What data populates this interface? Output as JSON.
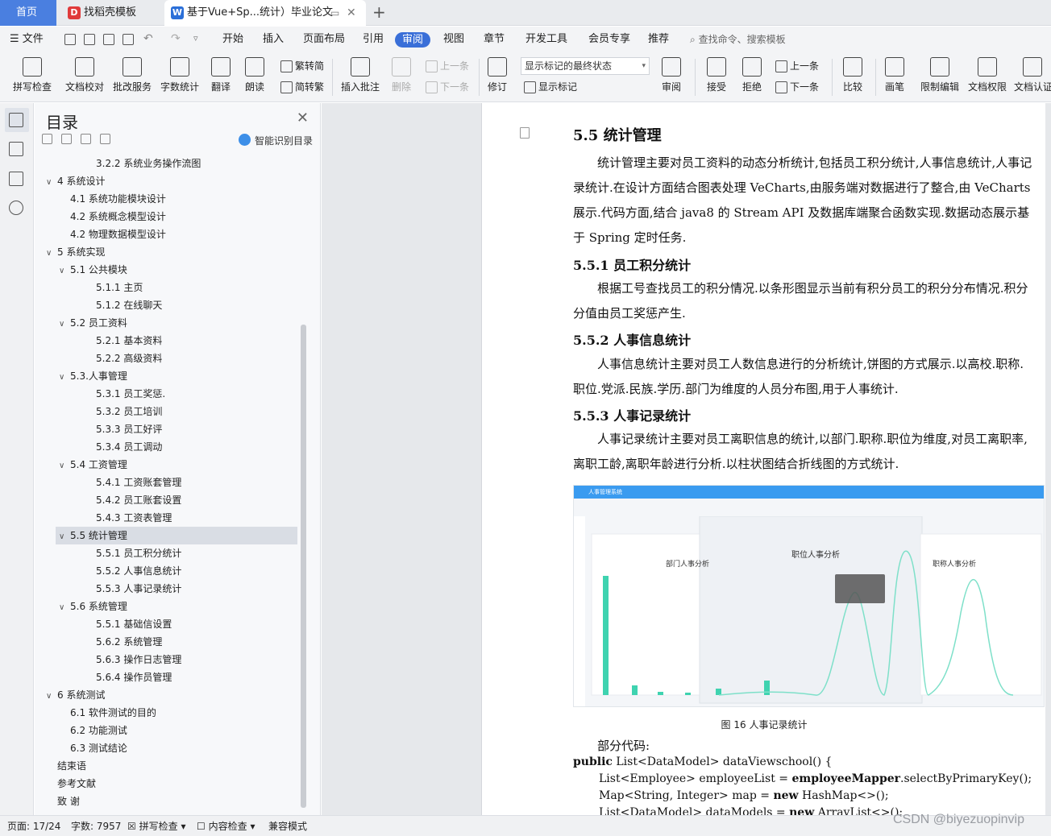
{
  "tabs": {
    "home": "首页",
    "template": "找稻壳模板",
    "doc": "基于Vue+Sp...统计）毕业论文"
  },
  "menu": {
    "file": "文件",
    "items": [
      "开始",
      "插入",
      "页面布局",
      "引用",
      "审阅",
      "视图",
      "章节",
      "开发工具",
      "会员专享",
      "推荐"
    ],
    "active": "审阅",
    "search": "查找命令、搜索模板"
  },
  "ribbon": {
    "spellcheck": "拼写检查",
    "doc_check": "文档校对",
    "batch_service": "批改服务",
    "word_count": "字数统计",
    "translate": "翻译",
    "read_aloud": "朗读",
    "trad_to_simp": "繁转简",
    "simp_to_trad": "简转繁",
    "insert_comment": "插入批注",
    "delete": "删除",
    "prev_comment": "上一条",
    "next_comment": "下一条",
    "revise": "修订",
    "markup_select": "显示标记的最终状态",
    "show_markup": "显示标记",
    "review": "审阅",
    "accept": "接受",
    "reject": "拒绝",
    "prev_change": "上一条",
    "next_change": "下一条",
    "compare": "比较",
    "ink": "画笔",
    "restrict_edit": "限制编辑",
    "doc_rights": "文档权限",
    "doc_auth": "文档认证"
  },
  "toc": {
    "title": "目录",
    "smart_detect": "智能识别目录",
    "items": [
      {
        "label": "3.2.2 系统业务操作流图",
        "level": 3,
        "arrow": ""
      },
      {
        "label": "4 系统设计",
        "level": 1,
        "arrow": "∨"
      },
      {
        "label": "4.1 系统功能模块设计",
        "level": 2,
        "arrow": ""
      },
      {
        "label": "4.2 系统概念模型设计",
        "level": 2,
        "arrow": ""
      },
      {
        "label": "4.2 物理数据模型设计",
        "level": 2,
        "arrow": ""
      },
      {
        "label": "5 系统实现",
        "level": 1,
        "arrow": "∨"
      },
      {
        "label": "5.1  公共模块",
        "level": 2,
        "arrow": "∨"
      },
      {
        "label": "5.1.1 主页",
        "level": 3,
        "arrow": ""
      },
      {
        "label": "5.1.2 在线聊天",
        "level": 3,
        "arrow": ""
      },
      {
        "label": "5.2  员工资料",
        "level": 2,
        "arrow": "∨"
      },
      {
        "label": "5.2.1 基本资料",
        "level": 3,
        "arrow": ""
      },
      {
        "label": "5.2.2  高级资料",
        "level": 3,
        "arrow": ""
      },
      {
        "label": "5.3.人事管理",
        "level": 2,
        "arrow": "∨"
      },
      {
        "label": "5.3.1 员工奖惩.",
        "level": 3,
        "arrow": ""
      },
      {
        "label": "5.3.2 员工培训",
        "level": 3,
        "arrow": ""
      },
      {
        "label": "5.3.3 员工好评",
        "level": 3,
        "arrow": ""
      },
      {
        "label": "5.3.4 员工调动",
        "level": 3,
        "arrow": ""
      },
      {
        "label": "5.4 工资管理",
        "level": 2,
        "arrow": "∨"
      },
      {
        "label": "5.4.1 工资账套管理",
        "level": 3,
        "arrow": ""
      },
      {
        "label": "5.4.2 员工账套设置",
        "level": 3,
        "arrow": ""
      },
      {
        "label": "5.4.3 工资表管理",
        "level": 3,
        "arrow": ""
      },
      {
        "label": "5.5 统计管理",
        "level": 2,
        "arrow": "∨",
        "selected": true
      },
      {
        "label": "5.5.1 员工积分统计",
        "level": 3,
        "arrow": ""
      },
      {
        "label": "5.5.2 人事信息统计",
        "level": 3,
        "arrow": ""
      },
      {
        "label": "5.5.3 人事记录统计",
        "level": 3,
        "arrow": ""
      },
      {
        "label": "5.6 系统管理",
        "level": 2,
        "arrow": "∨"
      },
      {
        "label": "5.5.1 基础信设置",
        "level": 3,
        "arrow": ""
      },
      {
        "label": "5.6.2 系统管理",
        "level": 3,
        "arrow": ""
      },
      {
        "label": "5.6.3 操作日志管理",
        "level": 3,
        "arrow": ""
      },
      {
        "label": "5.6.4 操作员管理",
        "level": 3,
        "arrow": ""
      },
      {
        "label": "6 系统测试",
        "level": 1,
        "arrow": "∨"
      },
      {
        "label": "6.1  软件测试的目的",
        "level": 2,
        "arrow": ""
      },
      {
        "label": "6.2  功能测试",
        "level": 2,
        "arrow": ""
      },
      {
        "label": "6.3  测试结论",
        "level": 2,
        "arrow": ""
      },
      {
        "label": "结束语",
        "level": 1,
        "arrow": ""
      },
      {
        "label": "参考文献",
        "level": 1,
        "arrow": ""
      },
      {
        "label": "致    谢",
        "level": 1,
        "arrow": ""
      }
    ]
  },
  "doc": {
    "h_55": "5.5 统计管理",
    "p_55": "统计管理主要对员工资料的动态分析统计,包括员工积分统计,人事信息统计,人事记录统计.在设计方面结合图表处理 VeCharts,由服务端对数据进行了整合,由 VeCharts 展示.代码方面,结合 java8 的 Stream API 及数据库端聚合函数实现.数据动态展示基于 Spring 定时任务.",
    "h_551": "5.5.1 员工积分统计",
    "p_551": "根据工号查找员工的积分情况.以条形图显示当前有积分员工的积分分布情况.积分分值由员工奖惩产生.",
    "h_552": "5.5.2 人事信息统计",
    "p_552": "人事信息统计主要对员工人数信息进行的分析统计,饼图的方式展示.以高校.职称.职位.党派.民族.学历.部门为维度的人员分布图,用于人事统计.",
    "h_553": "5.5.3 人事记录统计",
    "p_553": "人事记录统计主要对员工离职信息的统计,以部门.职称.职位为维度,对员工离职率,离职工龄,离职年龄进行分析.以柱状图结合折线图的方式统计.",
    "figure": {
      "app_title": "人事管理系统",
      "chart_left_title": "部门人事分析",
      "chart_center_title": "职位人事分析",
      "chart_right_title": "职称人事分析"
    },
    "caption": "图 16  人事记录统计",
    "code_intro": "部分代码:",
    "code": [
      {
        "kw": "public",
        "rest": " List<DataModel> dataViewschool() {"
      },
      {
        "kw": "",
        "rest": "List<Employee> employeeList = ",
        "bold": "employeeMapper",
        "tail": ".selectByPrimaryKey();"
      },
      {
        "kw": "",
        "rest": "Map<String, Integer> map = ",
        "bold": "new",
        "tail": " HashMap<>();"
      },
      {
        "kw": "",
        "rest": "List<DataModel> dataModels = ",
        "bold": "new",
        "tail": " ArrayList<>();"
      }
    ]
  },
  "status": {
    "page": "页面: 17/24",
    "words": "字数: 7957",
    "spell": "拼写检查",
    "content": "内容检查",
    "compat": "兼容模式"
  },
  "watermark": "CSDN @biyezuopinvip",
  "colors": {
    "accent": "#3a6fd8",
    "tab_home": "#4a7fe0",
    "chart_bar": "#3fd3b0",
    "chart_line": "#7ee0c9"
  }
}
